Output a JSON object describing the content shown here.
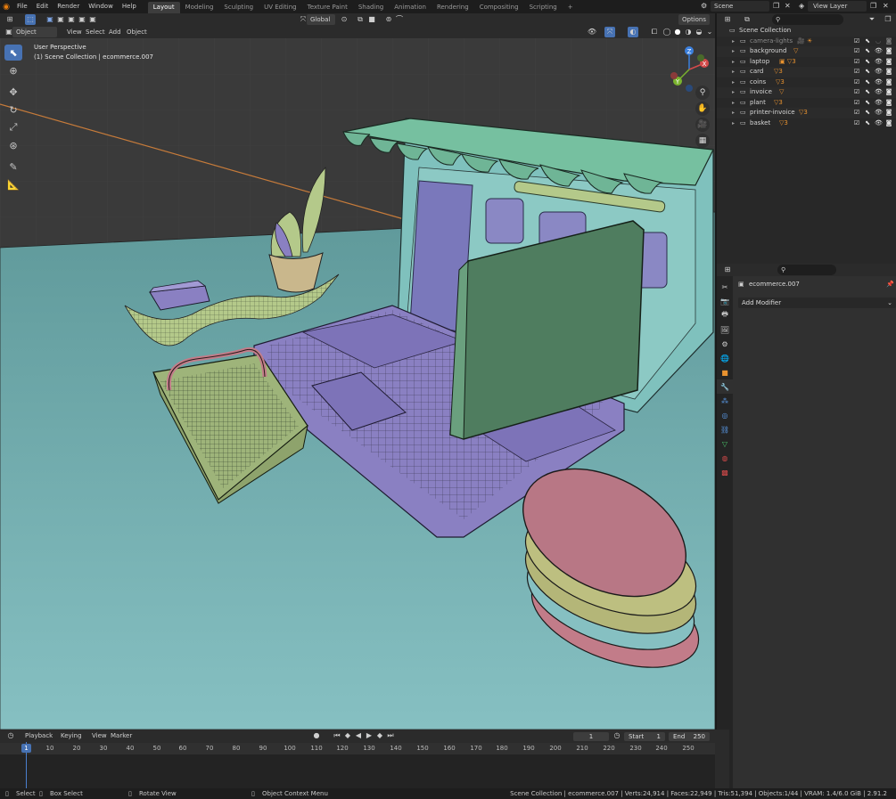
{
  "menubar": {
    "items": [
      "File",
      "Edit",
      "Render",
      "Window",
      "Help"
    ]
  },
  "workspaces": {
    "tabs": [
      "Layout",
      "Modeling",
      "Sculpting",
      "UV Editing",
      "Texture Paint",
      "Shading",
      "Animation",
      "Rendering",
      "Compositing",
      "Scripting"
    ],
    "active": "Layout",
    "add": "+"
  },
  "scene": {
    "name": "Scene",
    "view_layer": "View Layer"
  },
  "viewport_header": {
    "mode": "Object Mode",
    "menus": [
      "View",
      "Select",
      "Add",
      "Object"
    ],
    "orientation": "Global",
    "options": "Options"
  },
  "viewport": {
    "perspective": "User Perspective",
    "collection_info": "(1) Scene Collection | ecommerce.007"
  },
  "gizmo": {
    "x": "X",
    "y": "Y",
    "z": "Z"
  },
  "outliner": {
    "root": "Scene Collection",
    "items": [
      {
        "name": "camera-lights",
        "tags": "🎥 ☀",
        "dim": true
      },
      {
        "name": "background",
        "tags": "▽"
      },
      {
        "name": "laptop",
        "tags": "▣ ▽3"
      },
      {
        "name": "card",
        "tags": "▽3"
      },
      {
        "name": "coins",
        "tags": "▽3"
      },
      {
        "name": "invoice",
        "tags": "▽"
      },
      {
        "name": "plant",
        "tags": "▽3"
      },
      {
        "name": "printer-invoice",
        "tags": "▽3"
      },
      {
        "name": "basket",
        "tags": "▽3"
      }
    ]
  },
  "properties": {
    "object": "ecommerce.007",
    "add_modifier": "Add Modifier"
  },
  "timeline": {
    "menus": [
      "Playback",
      "Keying",
      "View",
      "Marker"
    ],
    "current_frame": "1",
    "start_label": "Start",
    "start": "1",
    "end_label": "End",
    "end": "250",
    "ruler": [
      "1",
      "10",
      "20",
      "30",
      "40",
      "50",
      "60",
      "70",
      "80",
      "90",
      "100",
      "110",
      "120",
      "130",
      "140",
      "150",
      "160",
      "170",
      "180",
      "190",
      "200",
      "210",
      "220",
      "230",
      "240",
      "250"
    ]
  },
  "statusbar": {
    "select": "Select",
    "box_select": "Box Select",
    "rotate_view": "Rotate View",
    "context_menu": "Object Context Menu",
    "stats": "Scene Collection | ecommerce.007 | Verts:24,914 | Faces:22,949 | Tris:51,394 | Objects:1/44 | VRAM: 1.4/6.0 GiB | 2.91.2"
  },
  "colors": {
    "accent": "#4772b3",
    "floor": "#6fa8aa",
    "laptop": "#8a80c2",
    "screen": "#4f7d5f",
    "awning": "#6fb596",
    "coin_pink": "#b87785",
    "coin_yellow": "#b4b678",
    "basket": "#9eb47a",
    "orange": "#e8922f"
  }
}
